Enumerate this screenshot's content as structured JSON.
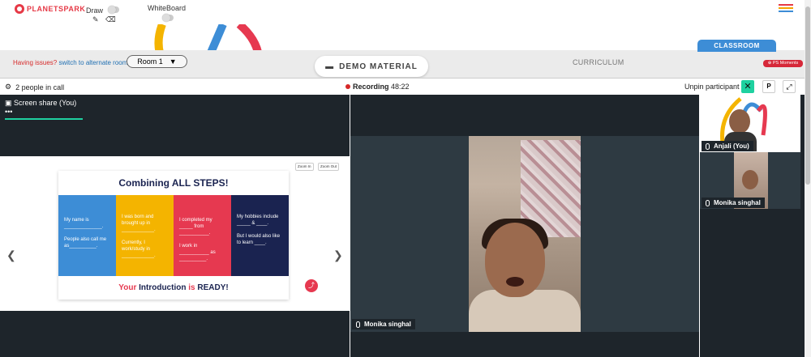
{
  "topbar": {
    "logo_text": "PLANETSPARK",
    "draw_label": "Draw",
    "whiteboard_label": "WhiteBoard",
    "menu_colors": [
      "#e63946",
      "#f4a300",
      "#3d8dd6"
    ]
  },
  "subbar": {
    "issues_text": "Having issues?",
    "alt_room_link": "switch to alternate room",
    "room_label": "Room 1",
    "demo_material": "DEMO MATERIAL",
    "curriculum": "CURRICULUM",
    "classroom": "CLASSROOM",
    "ps_moments": "PS Moments"
  },
  "callbar": {
    "people_in_call": "2 people in call",
    "recording_label": "Recording",
    "recording_time": "48:22",
    "unpin_label": "Unpin participant",
    "pin_btn": "P"
  },
  "screenshare": {
    "tab_label": "Screen share (You)",
    "more": "•••",
    "zoom_in": "Zoom In",
    "zoom_out": "Zoom Out"
  },
  "slide": {
    "title": "Combining ALL STEPS!",
    "cards": [
      {
        "color": "#3d8dd6",
        "lines": [
          "My name is ______________.",
          "People also call me as__________."
        ]
      },
      {
        "color": "#f4b400",
        "lines": [
          "I was born and brought up in ____________.",
          "Currently, I work/study in ____________."
        ]
      },
      {
        "color": "#e63950",
        "lines": [
          "I completed my _____ from ___________.",
          "I work in ___________ as __________."
        ]
      },
      {
        "color": "#1a2350",
        "lines": [
          "My hobbies include _____ & ____.",
          "But I would also like to learn ____."
        ]
      }
    ],
    "foot_a": "Your",
    "foot_b": " Introduction ",
    "foot_c": "is",
    "foot_d": " READY!"
  },
  "participants": {
    "main": "Monika singhal",
    "side1": "Anjali (You)",
    "side2": "Monika singhal"
  }
}
